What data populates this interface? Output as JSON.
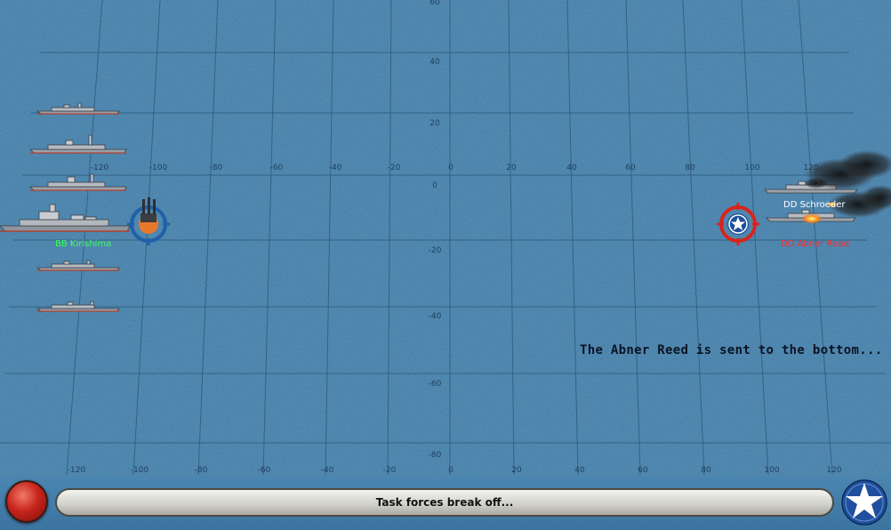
{
  "grid": {
    "x_ticks_upper": [
      "-120",
      "-100",
      "-80",
      "-60",
      "-40",
      "-20",
      "0",
      "20",
      "40",
      "60",
      "80",
      "100",
      "120"
    ],
    "x_ticks_lower": [
      "-120",
      "-100",
      "-80",
      "-60",
      "-40",
      "-20",
      "0",
      "20",
      "40",
      "60",
      "80",
      "100",
      "120"
    ],
    "y_ticks": [
      "60",
      "40",
      "20",
      "0",
      "-20",
      "-40",
      "-60",
      "-80"
    ]
  },
  "enemy_fleet": {
    "flagship_label": "BB Kirishima",
    "label_color": "#3cff5a"
  },
  "allied_fleet": {
    "ship_1_label": "DD Schroeder",
    "ship_2_label": "DD Abner Read",
    "ship_1_color": "#ffffff",
    "ship_2_color": "#ff2a2a"
  },
  "narration": "The Abner Reed is sent to the bottom...",
  "status_bar": {
    "text": "Task forces break off..."
  },
  "icons": {
    "record_button": "record-icon",
    "faction_button": "us-star-roundel-icon",
    "enemy_target": "turret-target-icon",
    "allied_target": "star-target-icon"
  }
}
